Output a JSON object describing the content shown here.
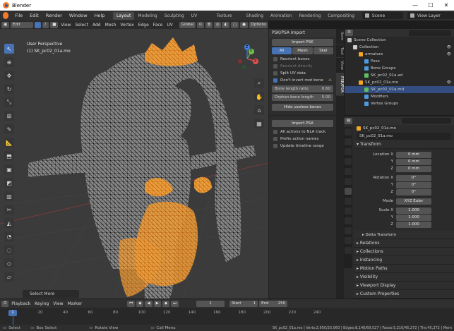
{
  "window": {
    "app_title": "Blender",
    "minimize": "—",
    "maximize": "☐",
    "close": "✕"
  },
  "menu": {
    "items": [
      "File",
      "Edit",
      "Render",
      "Window",
      "Help"
    ],
    "workspaces": [
      "Layout",
      "Modeling",
      "Sculpting",
      "UV Editing",
      "Texture Paint",
      "Shading",
      "Animation",
      "Rendering",
      "Compositing"
    ],
    "active_workspace": "Layout",
    "scene_label": "Scene",
    "view_layer_label": "View Layer"
  },
  "viewport_header": {
    "mode": "Edit Mode",
    "menus": [
      "View",
      "Select",
      "Add",
      "Mesh",
      "Vertex",
      "Edge",
      "Face",
      "UV"
    ],
    "orientation": "Global",
    "options": "Options"
  },
  "viewport": {
    "perspective": "User Perspective",
    "object_info": "(1) SK_pc02_01a.mo",
    "axis_x": "X",
    "axis_y": "Y",
    "axis_z": "Z",
    "select_more": "Select More"
  },
  "npanel": {
    "title": "PSK/PSA Import",
    "import_psk": "Import PSK",
    "seg_all": "All",
    "seg_mesh": "Mesh",
    "seg_skel": "Skel",
    "reorient_bones": "Reorient bones",
    "reorient_directly": "Reorient directly",
    "split_uv": "Split UV data",
    "dont_invert_root": "Don't invert root bone",
    "bone_length_label": "Bone length ratio",
    "bone_length_value": "0.60",
    "orphan_bone_label": "Orphan bone length",
    "orphan_bone_value": "5.00",
    "hide_useless": "Hide useless bones",
    "import_psa": "Import PSA",
    "all_actions_nla": "All actions to NLA track",
    "prefix_names": "Prefix action names",
    "update_timeline": "Update timeline range",
    "tabs": [
      "Item",
      "Tool",
      "View",
      "PSK/PSA"
    ]
  },
  "outliner": {
    "rows": [
      {
        "label": "Scene Collection",
        "indent": 0,
        "icon": "#bfbfbf"
      },
      {
        "label": "Collection",
        "indent": 1,
        "icon": "#cfcfcf"
      },
      {
        "label": "armature",
        "indent": 2,
        "icon": "#f5a623"
      },
      {
        "label": "Pose",
        "indent": 3,
        "icon": "#4a9be0"
      },
      {
        "label": "Bone Groups",
        "indent": 3,
        "icon": "#4a9be0"
      },
      {
        "label": "SK_pc02_01a.ad",
        "indent": 3,
        "icon": "#60c060"
      },
      {
        "label": "SK_pc02_01a.mo",
        "indent": 2,
        "icon": "#f5a623"
      },
      {
        "label": "SK_pc02_01a.md",
        "indent": 3,
        "icon": "#60c060",
        "selected": true
      },
      {
        "label": "Modifiers",
        "indent": 3,
        "icon": "#4a9be0"
      },
      {
        "label": "Vertex Groups",
        "indent": 3,
        "icon": "#4a9be0"
      }
    ]
  },
  "properties": {
    "object_path": "SK_pc02_01a.mo",
    "object_name": "SK_pc02_01a.mo",
    "transform_title": "Transform",
    "location_x": "Location X",
    "loc_y": "Y",
    "loc_z": "Z",
    "loc_vals": [
      "0 mm",
      "0 mm",
      "0 mm"
    ],
    "rotation_x": "Rotation X",
    "rot_y": "Y",
    "rot_z": "Z",
    "rot_vals": [
      "0°",
      "0°",
      "0°"
    ],
    "mode_label": "Mode",
    "mode_value": "XYZ Euler",
    "scale_x": "Scale X",
    "sc_y": "Y",
    "sc_z": "Z",
    "scale_vals": [
      "1.000",
      "1.000",
      "1.000"
    ],
    "delta": "Delta Transform",
    "sections": [
      "Relations",
      "Collections",
      "Instancing",
      "Motion Paths",
      "Visibility",
      "Viewport Display",
      "Custom Properties"
    ]
  },
  "timeline": {
    "menus": [
      "Playback",
      "Keying",
      "View",
      "Marker"
    ],
    "current_frame": "1",
    "start_label": "Start",
    "start_value": "1",
    "end_label": "End",
    "end_value": "250",
    "ticks": [
      "1",
      "20",
      "40",
      "60",
      "80",
      "100",
      "120",
      "140",
      "160",
      "180",
      "200",
      "220",
      "240"
    ],
    "playhead": "1"
  },
  "status": {
    "select": "Select",
    "box_select": "Box Select",
    "rotate_view": "Rotate View",
    "call_menu": "Call Menu",
    "stats": "SK_pc02_01a.mo | Verts:2,950/25,060 | Edges:8,146/69,527 | Faces:5,210/45,272 | Tris:45,272 | Mem"
  },
  "colors": {
    "accent": "#4772b3",
    "selection_orange": "#f5a623",
    "header": "#303030"
  }
}
